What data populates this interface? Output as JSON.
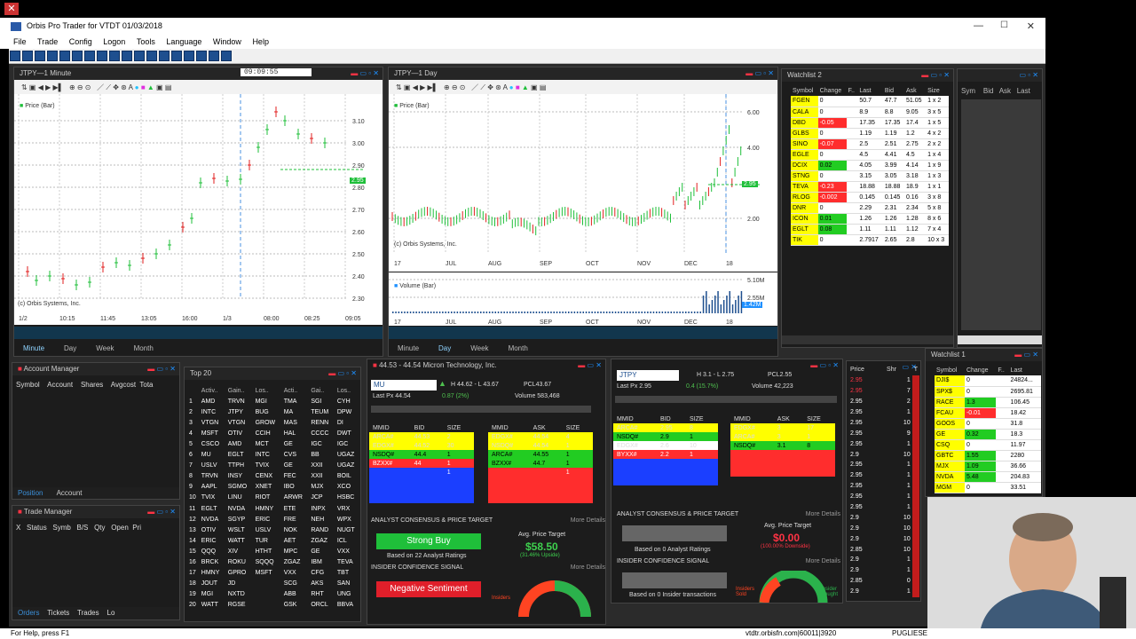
{
  "app": {
    "title": "Orbis Pro Trader for VTDT  01/03/2018"
  },
  "menu": [
    "File",
    "Trade",
    "Config",
    "Logon",
    "Tools",
    "Language",
    "Window",
    "Help"
  ],
  "chart_minute": {
    "title": "JTPY—1 Minute",
    "time_box": "09:09:55",
    "series_label": "Price (Bar)",
    "watermark": "(c) Orbis Systems, Inc.",
    "y_ticks": [
      "3.10",
      "3.00",
      "2.90",
      "2.80",
      "2.70",
      "2.60",
      "2.50",
      "2.40",
      "2.30"
    ],
    "price_tag": "2.95",
    "x_ticks": [
      "1/2",
      "10:15",
      "11:45",
      "13:05",
      "16:00",
      "1/3",
      "08:00",
      "08:25",
      "09:05"
    ],
    "tabs": [
      "Minute",
      "Day",
      "Week",
      "Month"
    ]
  },
  "chart_day": {
    "title": "JTPY—1 Day",
    "series_label": "Price (Bar)",
    "watermark": "(c) Orbis Systems, Inc.",
    "y_ticks": [
      "6.00",
      "4.00",
      "2.00"
    ],
    "price_tag": "2.95",
    "x_ticks": [
      "17",
      "JUL",
      "AUG",
      "SEP",
      "OCT",
      "NOV",
      "DEC",
      "18"
    ],
    "volume_label": "Volume (Bar)",
    "vol_ticks": [
      "5.10M",
      "2.55M"
    ],
    "vol_tag": "1.42M",
    "tabs": [
      "Minute",
      "Day",
      "Week",
      "Month"
    ]
  },
  "watchlist2": {
    "title": "Watchlist 2",
    "columns": [
      "Symbol",
      "Change",
      "F..",
      "Last",
      "Bid",
      "Ask",
      "Size"
    ],
    "rows": [
      [
        "FGEN",
        "0",
        "",
        "50.7",
        "47.7",
        "51.05",
        "1 x 2"
      ],
      [
        "CALA",
        "0",
        "",
        "8.9",
        "8.8",
        "9.05",
        "3 x 5"
      ],
      [
        "DBD",
        "-0.05",
        "",
        "17.35",
        "17.35",
        "17.4",
        "1 x 5"
      ],
      [
        "GLBS",
        "0",
        "",
        "1.19",
        "1.19",
        "1.2",
        "4 x 2"
      ],
      [
        "SINO",
        "-0.07",
        "",
        "2.5",
        "2.51",
        "2.75",
        "2 x 2"
      ],
      [
        "EGLE",
        "0",
        "",
        "4.5",
        "4.41",
        "4.5",
        "1 x 4"
      ],
      [
        "DCIX",
        "0.02",
        "",
        "4.05",
        "3.99",
        "4.14",
        "1 x 9"
      ],
      [
        "STNG",
        "0",
        "",
        "3.15",
        "3.05",
        "3.18",
        "1 x 3"
      ],
      [
        "TEVA",
        "-0.23",
        "",
        "18.88",
        "18.88",
        "18.9",
        "1 x 1"
      ],
      [
        "RLOG",
        "-0.002",
        "",
        "0.145",
        "0.145",
        "0.16",
        "3 x 8"
      ],
      [
        "DNR",
        "0",
        "",
        "2.29",
        "2.31",
        "2.34",
        "5 x 8"
      ],
      [
        "ICON",
        "0.01",
        "",
        "1.26",
        "1.26",
        "1.28",
        "8 x 6"
      ],
      [
        "EGLT",
        "0.08",
        "",
        "1.11",
        "1.11",
        "1.12",
        "7 x 4"
      ],
      [
        "TIK",
        "0",
        "",
        "2.7917",
        "2.65",
        "2.8",
        "10 x 3"
      ]
    ]
  },
  "mini_list": {
    "columns": [
      "Sym",
      "Bid",
      "Ask",
      "Last"
    ]
  },
  "account_manager": {
    "title": "Account Manager",
    "columns": [
      "Symbol",
      "Account",
      "Shares",
      "Avgcost",
      "Tota"
    ],
    "tabs": [
      "Position",
      "Account"
    ]
  },
  "trade_manager": {
    "title": "Trade Manager",
    "columns": [
      "X",
      "Status",
      "Symb",
      "B/S",
      "Qty",
      "Open",
      "Pri"
    ],
    "tabs": [
      "Orders",
      "Tickets",
      "Trades",
      "Lo"
    ]
  },
  "top20": {
    "title": "Top 20",
    "columns": [
      "Activ..",
      "Gain..",
      "Los..",
      "Acti..",
      "Gai..",
      "Los.."
    ],
    "rows": [
      [
        "1",
        "AMD",
        "TRVN",
        "MGI",
        "TMA",
        "SGI",
        "CYH"
      ],
      [
        "2",
        "INTC",
        "JTPY",
        "BUG",
        "MA",
        "TEUM",
        "DPW"
      ],
      [
        "3",
        "VTGN",
        "VTGN",
        "GROW",
        "MAS",
        "RENN",
        "DI"
      ],
      [
        "4",
        "MSFT",
        "OTIV",
        "CCIH",
        "HAL",
        "CCCC",
        "DWT"
      ],
      [
        "5",
        "CSCO",
        "AMD",
        "MCT",
        "GE",
        "IGC",
        "IGC"
      ],
      [
        "6",
        "MU",
        "EGLT",
        "INTC",
        "CVS",
        "BB",
        "UGAZ"
      ],
      [
        "7",
        "USLV",
        "TTPH",
        "TVIX",
        "GE",
        "XXII",
        "UGAZ"
      ],
      [
        "8",
        "TRVN",
        "INSY",
        "CENX",
        "FEC",
        "XXII",
        "BOIL"
      ],
      [
        "9",
        "AAPL",
        "SGMO",
        "XNET",
        "IBO",
        "MJX",
        "XCO"
      ],
      [
        "10",
        "TVIX",
        "LINU",
        "RIOT",
        "ARWR",
        "JCP",
        "HSBC"
      ],
      [
        "11",
        "EGLT",
        "NVDA",
        "HMNY",
        "ETE",
        "INPX",
        "VRX"
      ],
      [
        "12",
        "NVDA",
        "SGYP",
        "ERIC",
        "FRE",
        "NEH",
        "WPX"
      ],
      [
        "13",
        "OTIV",
        "WSLT",
        "USLV",
        "NOK",
        "RAND",
        "NUGT"
      ],
      [
        "14",
        "ERIC",
        "WATT",
        "TUR",
        "AET",
        "ZGAZ",
        "ICL"
      ],
      [
        "15",
        "QQQ",
        "XIV",
        "HTHT",
        "MPC",
        "GE",
        "VXX"
      ],
      [
        "16",
        "BRCK",
        "ROKU",
        "SQQQ",
        "ZGAZ",
        "IBM",
        "TEVA"
      ],
      [
        "17",
        "HMNY",
        "GPRO",
        "MSFT",
        "VXX",
        "CFG",
        "TBT"
      ],
      [
        "18",
        "JOUT",
        "JD",
        "",
        "SCG",
        "AKS",
        "SAN"
      ],
      [
        "19",
        "MGI",
        "NXTD",
        "",
        "ABB",
        "RHT",
        "UNG"
      ],
      [
        "20",
        "WATT",
        "RGSE",
        "",
        "GSK",
        "ORCL",
        "BBVA"
      ]
    ]
  },
  "level2_mu": {
    "title": "44.53 - 44.54   Micron Technology, Inc.",
    "symbol": "MU",
    "high_low": "H 44.62 - L 43.67",
    "pcl": "PCL43.67",
    "last_px": "Last Px  44.54",
    "change": "0.87  (2%)",
    "volume": "Volume     583,468",
    "bid_cols": [
      "MMID",
      "BID",
      "SIZE"
    ],
    "ask_cols": [
      "MMID",
      "ASK",
      "SIZE"
    ],
    "bids": [
      [
        "ARCA#",
        "44.53",
        "2"
      ],
      [
        "EDGX#",
        "44.52",
        "30"
      ],
      [
        "NSDQ#",
        "44.4",
        "1"
      ],
      [
        "BZXX#",
        "44",
        "1"
      ],
      [
        "",
        "",
        "1"
      ]
    ],
    "asks": [
      [
        "EDGX#",
        "44.54",
        "4"
      ],
      [
        "NSDQ#",
        "44.54",
        "1"
      ],
      [
        "ARCA#",
        "44.55",
        "1"
      ],
      [
        "BZXX#",
        "44.7",
        "1"
      ],
      [
        "",
        "",
        "1"
      ]
    ],
    "consensus_title": "ANALYST CONSENSUS & PRICE TARGET",
    "more_details": "More Details",
    "consensus_button": "Strong Buy",
    "analyst_basis": "Based on 22 Analyst Ratings",
    "avg_target_label": "Avg. Price Target",
    "avg_target": "$58.50",
    "upside": "(31.46% Upside)",
    "insider_title": "INSIDER CONFIDENCE SIGNAL",
    "insider_button": "Negative Sentiment",
    "insiders_label": "Insiders"
  },
  "level2_jtpy": {
    "symbol": "JTPY",
    "high_low": "H 3.1 - L 2.75",
    "pcl": "PCL2.55",
    "last_px": "Last Px   2.95",
    "change": "0.4  (15.7%)",
    "volume": "Volume     42,223",
    "bid_cols": [
      "MMID",
      "BID",
      "SIZE"
    ],
    "ask_cols": [
      "MMID",
      "ASK",
      "SIZE"
    ],
    "bids": [
      [
        "ARCA#",
        "2.95",
        "8"
      ],
      [
        "NSDQ#",
        "2.9",
        "1"
      ],
      [
        "EDGX#",
        "2.6",
        "10"
      ],
      [
        "BYXX#",
        "2.2",
        "1"
      ]
    ],
    "asks": [
      [
        "EDGX#",
        "3",
        "17"
      ],
      [
        "ARCA#",
        "3",
        "1"
      ],
      [
        "NSDQ#",
        "3.1",
        "8"
      ]
    ],
    "consensus_title": "ANALYST CONSENSUS & PRICE TARGET",
    "more_details": "More Details",
    "analyst_basis": "Based on 0 Analyst Ratings",
    "avg_target_label": "Avg. Price Target",
    "avg_target": "$0.00",
    "downside": "(100.00% Downside)",
    "insider_title": "INSIDER CONFIDENCE SIGNAL",
    "insider_basis": "Based on 0 Insider transactions",
    "insiders_sold": "Insiders Sold",
    "insiders_bought": "Insider Bought"
  },
  "time_sales": {
    "columns": [
      "Price",
      "Shr",
      "T"
    ],
    "prices": [
      "2.95",
      "2.95",
      "2.95",
      "2.95",
      "2.95",
      "2.95",
      "2.95",
      "2.9",
      "2.95",
      "2.95",
      "2.95",
      "2.95",
      "2.95",
      "2.9",
      "2.9",
      "2.9",
      "2.85",
      "2.9",
      "2.9",
      "2.85",
      "2.9"
    ],
    "sizes": [
      "1",
      "7",
      "2",
      "1",
      "10",
      "9",
      "1",
      "10",
      "1",
      "1",
      "1",
      "1",
      "1",
      "10",
      "10",
      "10",
      "10",
      "1",
      "1",
      "0",
      "1"
    ]
  },
  "watchlist1": {
    "title": "Watchlist 1",
    "columns": [
      "Symbol",
      "Change",
      "F..",
      "Last"
    ],
    "rows": [
      [
        "DJI$",
        "0",
        "",
        "24824..."
      ],
      [
        "SPX$",
        "0",
        "",
        "2695.81"
      ],
      [
        "RACE",
        "1.3",
        "",
        "106.45"
      ],
      [
        "FCAU",
        "-0.01",
        "",
        "18.42"
      ],
      [
        "GOOS",
        "0",
        "",
        "31.8"
      ],
      [
        "GE",
        "0.32",
        "",
        "18.3"
      ],
      [
        "CSQ",
        "0",
        "",
        "11.97"
      ],
      [
        "GBTC",
        "1.55",
        "",
        "2280"
      ],
      [
        "MJX",
        "1.09",
        "",
        "36.66"
      ],
      [
        "NVDA",
        "5.48",
        "",
        "204.83"
      ],
      [
        "MGM",
        "0",
        "",
        "33.51"
      ]
    ]
  },
  "status": {
    "help": "For Help, press F1",
    "server": "vtdtr.orbisfn.com|60011|3920",
    "right": "PUGLIESE"
  },
  "colors": {
    "up": "#22cc22",
    "down": "#ff2d2d",
    "accent": "#1e90ff",
    "yellow": "#ffff00"
  }
}
